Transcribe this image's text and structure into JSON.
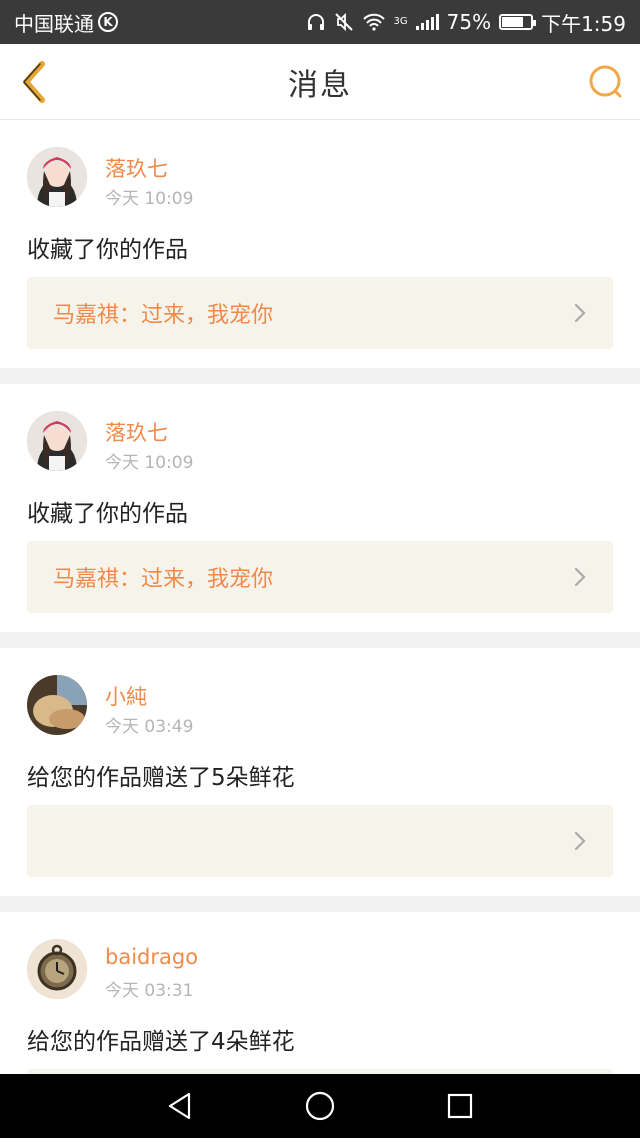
{
  "status_bar": {
    "carrier": "中国联通",
    "carrier_badge": "K",
    "network": "3G",
    "battery": "75%",
    "battery_level": 0.75,
    "time": "下午1:59",
    "icons": [
      "headphones-icon",
      "mute-icon",
      "wifi-icon",
      "signal-icon",
      "battery-icon"
    ]
  },
  "header": {
    "title": "消息",
    "back_icon": "chevron-left-icon",
    "search_icon": "search-icon",
    "accent_color": "#f0a84b"
  },
  "messages": [
    {
      "username": "落玖七",
      "time": "今天 10:09",
      "action": "收藏了你的作品",
      "quote": "马嘉祺：过来，我宠你",
      "avatar": "girl-avatar"
    },
    {
      "username": "落玖七",
      "time": "今天 10:09",
      "action": "收藏了你的作品",
      "quote": "马嘉祺：过来，我宠你",
      "avatar": "girl-avatar"
    },
    {
      "username": "小純",
      "time": "今天 03:49",
      "action": "给您的作品赠送了5朵鲜花",
      "quote": "",
      "avatar": "photo-avatar"
    },
    {
      "username": "baidrago",
      "time": "今天 03:31",
      "action": "给您的作品赠送了4朵鲜花",
      "quote": "",
      "avatar": "pocket-watch-avatar"
    }
  ],
  "colors": {
    "username": "#f08a4b",
    "quote_bg": "#f6f4ea",
    "page_bg": "#f2f2f2"
  },
  "nav_bar": {
    "buttons": [
      "back-triangle-icon",
      "home-circle-icon",
      "recents-square-icon"
    ]
  }
}
